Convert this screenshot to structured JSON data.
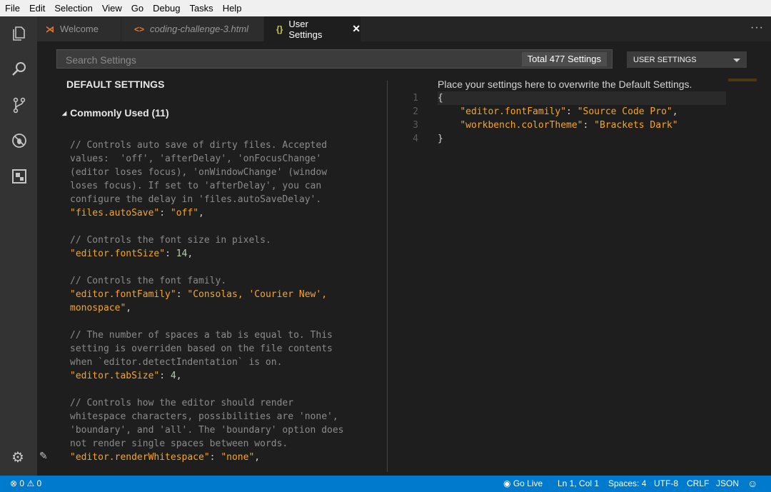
{
  "menu": [
    "File",
    "Edit",
    "Selection",
    "View",
    "Go",
    "Debug",
    "Tasks",
    "Help"
  ],
  "activity_bar": {
    "items": [
      "files-icon",
      "search-icon",
      "source-control-icon",
      "debug-icon",
      "extensions-icon"
    ],
    "bottom": "gear-icon"
  },
  "tabs": [
    {
      "label": "Welcome",
      "icon": "vscode-logo-icon",
      "italic": false,
      "active": false
    },
    {
      "label": "coding-challenge-3.html",
      "icon": "<>",
      "italic": true,
      "active": false
    },
    {
      "label": "User Settings",
      "icon": "{}",
      "italic": false,
      "active": true
    }
  ],
  "tab_close": "✕",
  "more_actions": "···",
  "search": {
    "placeholder": "Search Settings",
    "value": ""
  },
  "settings_count": "Total 477 Settings",
  "scope_select": {
    "selected": "USER SETTINGS"
  },
  "left": {
    "title": "DEFAULT SETTINGS",
    "group": "Commonly Used (11)",
    "blocks": [
      {
        "comment": [
          "// Controls auto save of dirty files. Accepted",
          "values:  'off', 'afterDelay', 'onFocusChange'",
          "(editor loses focus), 'onWindowChange' (window",
          "loses focus). If set to 'afterDelay', you can",
          "configure the delay in 'files.autoSaveDelay'."
        ],
        "key": "\"files.autoSave\"",
        "value": "\"off\"",
        "value_type": "string"
      },
      {
        "comment": [
          "// Controls the font size in pixels."
        ],
        "key": "\"editor.fontSize\"",
        "value": "14",
        "value_type": "number"
      },
      {
        "comment": [
          "// Controls the font family."
        ],
        "key": "\"editor.fontFamily\"",
        "value": "\"Consolas, 'Courier New',",
        "value_cont": "monospace\"",
        "value_type": "string"
      },
      {
        "comment": [
          "// The number of spaces a tab is equal to. This",
          "setting is overriden based on the file contents",
          "when `editor.detectIndentation` is on."
        ],
        "key": "\"editor.tabSize\"",
        "value": "4",
        "value_type": "number"
      },
      {
        "comment": [
          "// Controls how the editor should render",
          "whitespace characters, possibilities are 'none',",
          "'boundary', and 'all'. The 'boundary' option does",
          "not render single spaces between words."
        ],
        "key": "\"editor.renderWhitespace\"",
        "value": "\"none\"",
        "value_type": "string"
      }
    ]
  },
  "right": {
    "hint": "Place your settings here to overwrite the Default Settings.",
    "line_numbers": [
      "1",
      "2",
      "3",
      "4"
    ],
    "code": [
      {
        "text": "{"
      },
      {
        "key": "\"editor.fontFamily\"",
        "value": "\"Source Code Pro\"",
        "trail": ","
      },
      {
        "key": "\"workbench.colorTheme\"",
        "value": "\"Brackets Dark\"",
        "trail": ""
      },
      {
        "text": "}"
      }
    ]
  },
  "statusbar": {
    "errors": "0",
    "warnings": "0",
    "go_live": "Go Live",
    "position": "Ln 1, Col 1",
    "spaces": "Spaces: 4",
    "encoding": "UTF-8",
    "eol": "CRLF",
    "language": "JSON"
  },
  "colors": {
    "accent": "#007acc",
    "json_key": "#f5a623",
    "number": "#b5cea8",
    "comment": "#8b8b8b"
  }
}
